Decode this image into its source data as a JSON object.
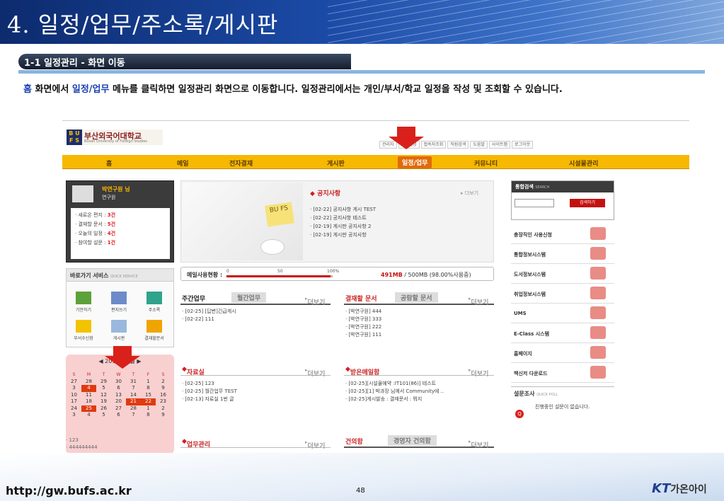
{
  "slide": {
    "title": "4. 일정/업무/주소록/게시판",
    "subtitle": "1-1 일정관리 - 화면 이동",
    "intro_1": "홈",
    "intro_2": " 화면에서 ",
    "intro_3": "일정/업무",
    "intro_4": " 메뉴를 클릭하면 일정관리 화면으로 이동합니다. 일정관리에서는 개인/부서/학교 일정을 작성 및 조회할 수 있습니다.",
    "url": "http://gw.bufs.ac.kr",
    "page": "48",
    "brand_mark": "KT",
    "brand_text": "가온아이"
  },
  "portal": {
    "logo_abbr": "B U F S",
    "logo_name": "부산외국어대학교",
    "logo_en": "Busan University of Foreign Studies",
    "toplinks": [
      "관리자",
      "정보설정",
      "접속자조회",
      "직원검색",
      "도움말",
      "사이트맵",
      "로그아웃"
    ],
    "nav": [
      "홈",
      "메일",
      "전자결재",
      "게시판",
      "일정/업무",
      "커뮤니티",
      "시설물관리"
    ],
    "profile": {
      "name": "박연구원 님",
      "dept": "연구원",
      "rows": [
        {
          "label": "새로온 편지 :",
          "value": "3건"
        },
        {
          "label": "결재할 문서 :",
          "value": "5건"
        },
        {
          "label": "오늘의 일정 :",
          "value": "4건"
        },
        {
          "label": "참여할 설문 :",
          "value": "1건"
        }
      ]
    },
    "quick": {
      "title": "바로가기 서비스",
      "sub": "QUICK SERVICE",
      "items": [
        "기안하기",
        "편지쓰기",
        "주소록",
        "부서수신함",
        "게시판",
        "결재할문서"
      ]
    },
    "calendar": {
      "header": "◀   2013년 2월   ▶",
      "dow": [
        "S",
        "M",
        "T",
        "W",
        "T",
        "F",
        "S"
      ],
      "weeks": [
        [
          "27",
          "28",
          "29",
          "30",
          "31",
          "1",
          "2"
        ],
        [
          "3",
          "4",
          "5",
          "6",
          "7",
          "8",
          "9"
        ],
        [
          "10",
          "11",
          "12",
          "13",
          "14",
          "15",
          "16"
        ],
        [
          "17",
          "18",
          "19",
          "20",
          "21",
          "22",
          "23"
        ],
        [
          "24",
          "25",
          "26",
          "27",
          "28",
          "1",
          "2"
        ],
        [
          "3",
          "4",
          "5",
          "6",
          "7",
          "8",
          "9"
        ]
      ],
      "notes": [
        "123",
        "444444444"
      ]
    },
    "notice": {
      "title": "공지사항",
      "more": "더보기",
      "sticky": "BU FS",
      "items": [
        "[02-22] 공지사항 게시 TEST",
        "[02-22] 공지사항 테스트",
        "[02-19] 게시판 공지사항 2",
        "[02-19] 게시판 공지사항"
      ]
    },
    "mail": {
      "label": "메일사용현황 :",
      "s0": "0",
      "s50": "50",
      "s100": "100%",
      "used": "491MB",
      "rest": " / 500MB (98.00%사용중)",
      "fraction": 0.98
    },
    "weekly": {
      "tab_on": "주간업무",
      "tab_off": "월간업무",
      "more": "더보기",
      "items": [
        "[02-25] [답변]긴급게시",
        "[02-22] 111"
      ]
    },
    "approval": {
      "tab_on": "결재할 문서",
      "tab_off": "공람할 문서",
      "more": "더보기",
      "items": [
        "[박연구원] 444",
        "[박연구원] 333",
        "[박연구원] 222",
        "[박연구원] 111"
      ]
    },
    "data": {
      "title": "자료실",
      "more": "더보기",
      "items": [
        "[02-25] 123",
        "[02-25] 월간업무 TEST",
        "[02-13] 자료실 1번 글"
      ]
    },
    "inbox": {
      "title": "받은메일함",
      "more": "더보기",
      "items": [
        "[02-25][시설물예약 :IT101(86)] 테스트",
        "[02-25][1] 박과장 님께서 Community에 ..",
        "[02-25]게시발송 : 결재문서 : 뭐지"
      ]
    },
    "task": {
      "title": "업무관리",
      "more": "더보기"
    },
    "suggest": {
      "tab_on": "건의함",
      "tab_off": "경영자 건의함",
      "more": "더보기"
    },
    "search": {
      "title": "통합검색",
      "sub": "SEARCH",
      "button": "검색하기",
      "value": ""
    },
    "links": [
      "총장직인 사용신청",
      "통합정보시스템",
      "도서정보시스템",
      "취업정보시스템",
      "UMS",
      "E-Class 시스템",
      "홈페이지",
      "백신저 다운로드"
    ],
    "poll": {
      "title": "설문조사",
      "sub": "QUICK POLL",
      "msg": "진행중인 설문이 없습니다."
    }
  }
}
